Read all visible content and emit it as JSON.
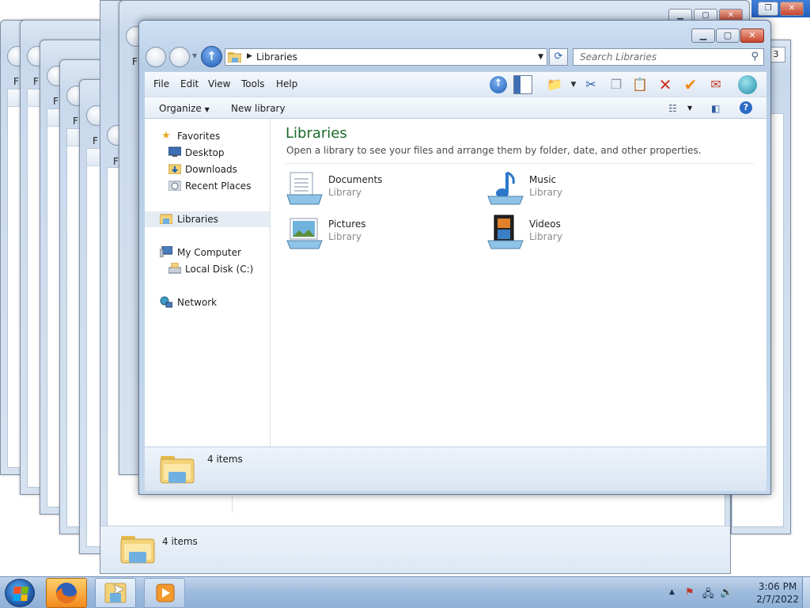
{
  "window": {
    "address_crumb": "Libraries",
    "search_placeholder": "Search Libraries"
  },
  "menu": [
    "File",
    "Edit",
    "View",
    "Tools",
    "Help"
  ],
  "command_bar": {
    "organize": "Organize",
    "new_library": "New library"
  },
  "nav_pane": {
    "favorites": "Favorites",
    "desktop": "Desktop",
    "downloads": "Downloads",
    "recent_places": "Recent Places",
    "libraries": "Libraries",
    "my_computer": "My Computer",
    "local_disk": "Local Disk (C:)",
    "network": "Network"
  },
  "main": {
    "title": "Libraries",
    "description": "Open a library to see your files and arrange them by folder, date, and other properties.",
    "libraries": [
      {
        "name": "Documents",
        "type": "Library",
        "icon": "documents-library-icon"
      },
      {
        "name": "Music",
        "type": "Library",
        "icon": "music-library-icon"
      },
      {
        "name": "Pictures",
        "type": "Library",
        "icon": "pictures-library-icon"
      },
      {
        "name": "Videos",
        "type": "Library",
        "icon": "videos-library-icon"
      }
    ]
  },
  "status": {
    "item_count": "4 items"
  },
  "background_window": {
    "menu_letter": "F",
    "item_count": "4 items"
  },
  "taskbar": {
    "time": "3:06 PM",
    "date": "2/7/2022",
    "apps": [
      "firefox",
      "windows-explorer",
      "media-player"
    ]
  },
  "colors": {
    "title_green": "#1b6a2a",
    "taskbar_blue": "#9fbcdd",
    "close_red": "#c9432b"
  }
}
